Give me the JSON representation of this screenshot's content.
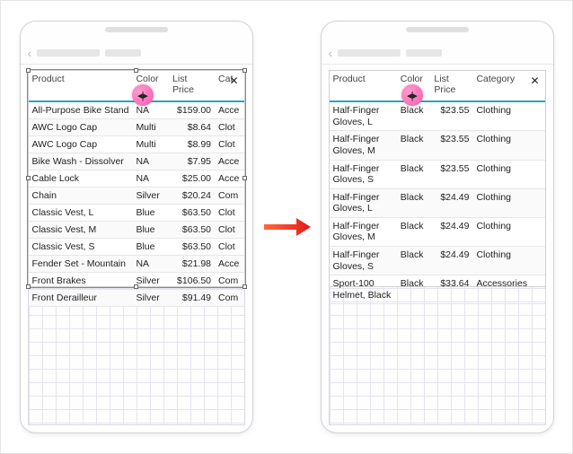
{
  "arrow_color": "#e31b1b",
  "resize_badge_color": "#ff6fb8",
  "header_accent": "#2aa4c3",
  "left": {
    "close": "✕",
    "resize_cursor": "↔",
    "columns": {
      "product": "Product",
      "color": "Color",
      "price": "List Price",
      "category": "Cat"
    },
    "col_widths": {
      "product": 100,
      "color": 35,
      "price": 44,
      "category": 28
    },
    "resize_dot_x": 115,
    "rows": [
      {
        "product": "All-Purpose Bike Stand",
        "color": "NA",
        "price": "$159.00",
        "category": "Acce"
      },
      {
        "product": "AWC Logo Cap",
        "color": "Multi",
        "price": "$8.64",
        "category": "Clot"
      },
      {
        "product": "AWC Logo Cap",
        "color": "Multi",
        "price": "$8.99",
        "category": "Clot"
      },
      {
        "product": "Bike Wash - Dissolver",
        "color": "NA",
        "price": "$7.95",
        "category": "Acce"
      },
      {
        "product": "Cable Lock",
        "color": "NA",
        "price": "$25.00",
        "category": "Acce"
      },
      {
        "product": "Chain",
        "color": "Silver",
        "price": "$20.24",
        "category": "Com"
      },
      {
        "product": "Classic Vest, L",
        "color": "Blue",
        "price": "$63.50",
        "category": "Clot"
      },
      {
        "product": "Classic Vest, M",
        "color": "Blue",
        "price": "$63.50",
        "category": "Clot"
      },
      {
        "product": "Classic Vest, S",
        "color": "Blue",
        "price": "$63.50",
        "category": "Clot"
      },
      {
        "product": "Fender Set - Mountain",
        "color": "NA",
        "price": "$21.98",
        "category": "Acce"
      },
      {
        "product": "Front Brakes",
        "color": "Silver",
        "price": "$106.50",
        "category": "Com"
      },
      {
        "product": "Front Derailleur",
        "color": "Silver",
        "price": "$91.49",
        "category": "Com"
      }
    ]
  },
  "right": {
    "close": "✕",
    "resize_cursor": "↔",
    "columns": {
      "product": "Product",
      "color": "Color",
      "price": "List Price",
      "category": "Category"
    },
    "col_widths": {
      "product": 64,
      "color": 32,
      "price": 40,
      "category": 68
    },
    "resize_dot_x": 80,
    "rows": [
      {
        "product": "Half-Finger Gloves, L",
        "color": "Black",
        "price": "$23.55",
        "category": "Clothing"
      },
      {
        "product": "Half-Finger Gloves, M",
        "color": "Black",
        "price": "$23.55",
        "category": "Clothing"
      },
      {
        "product": "Half-Finger Gloves, S",
        "color": "Black",
        "price": "$23.55",
        "category": "Clothing"
      },
      {
        "product": "Half-Finger Gloves, L",
        "color": "Black",
        "price": "$24.49",
        "category": "Clothing"
      },
      {
        "product": "Half-Finger Gloves, M",
        "color": "Black",
        "price": "$24.49",
        "category": "Clothing"
      },
      {
        "product": "Half-Finger Gloves, S",
        "color": "Black",
        "price": "$24.49",
        "category": "Clothing"
      },
      {
        "product": "Sport-100 Helmet, Black",
        "color": "Black",
        "price": "$33.64",
        "category": "Accessories"
      }
    ]
  }
}
